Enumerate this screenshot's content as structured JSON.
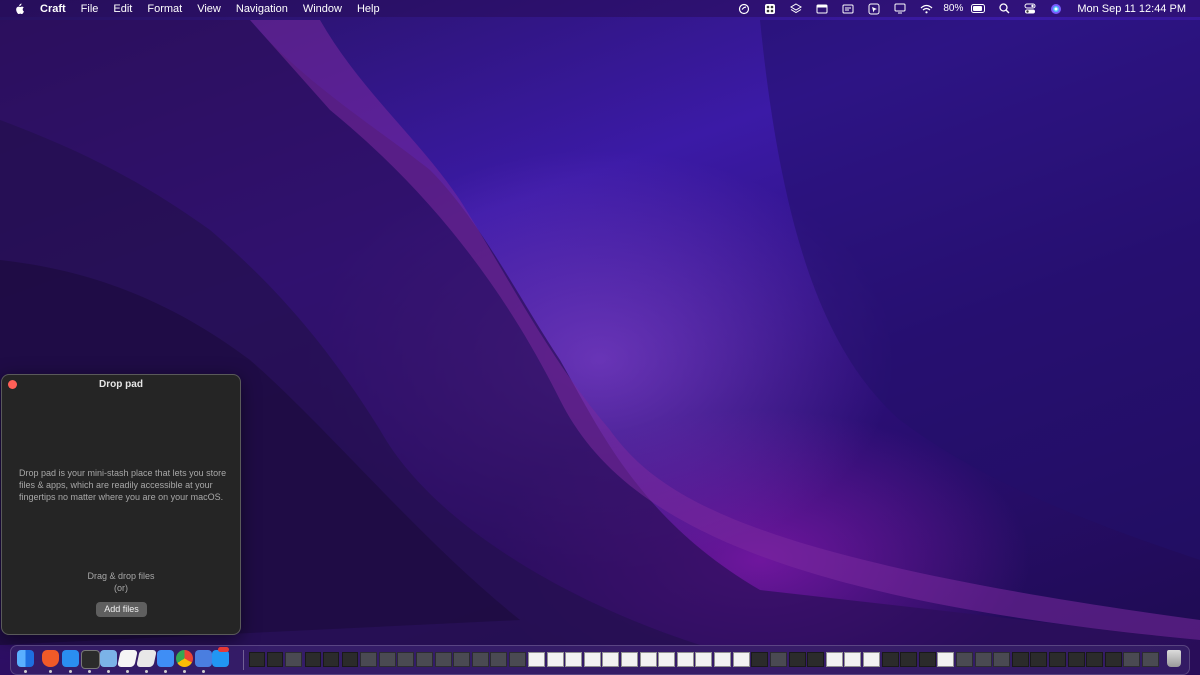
{
  "menubar": {
    "app_name": "Craft",
    "menus": [
      "File",
      "Edit",
      "Format",
      "View",
      "Navigation",
      "Window",
      "Help"
    ],
    "status_icons": [
      "focus-icon",
      "tools-icon",
      "layers-icon",
      "window-icon",
      "display-icon",
      "cursor-icon",
      "monitor-icon",
      "wifi-icon"
    ],
    "battery_percent": "80%",
    "clock": "Mon Sep 11  12:44 PM"
  },
  "drop_pad": {
    "title": "Drop pad",
    "description": "Drop pad is your mini-stash place that lets you store files & apps, which are readily accessible at your fingertips no matter where you are on your macOS.",
    "drag_text": "Drag & drop files",
    "or_text": "(or)",
    "add_button_label": "Add files"
  },
  "dock": {
    "apps": [
      {
        "name": "finder-icon",
        "color": "#1e7cf2"
      },
      {
        "name": "brave-icon",
        "color": "#f05a28"
      },
      {
        "name": "vscode-icon",
        "color": "#2a8ef0"
      },
      {
        "name": "terminal-icon",
        "color": "#2b2b2b"
      },
      {
        "name": "preview-icon",
        "color": "#7bb3e8"
      },
      {
        "name": "notes-icon",
        "color": "#f5f5f5"
      },
      {
        "name": "notes2-icon",
        "color": "#e8e8e8"
      },
      {
        "name": "xcode-icon",
        "color": "#3f8ef5"
      },
      {
        "name": "chrome-icon",
        "color": "#34a853"
      },
      {
        "name": "migrate-icon",
        "color": "#4a7ee0"
      },
      {
        "name": "app-store-icon",
        "color": "#2196f3"
      }
    ],
    "trash_icon": "trash-icon"
  },
  "colors": {
    "close_button": "#ff5f57",
    "window_bg": "#252525",
    "add_button_bg": "#5f5f5f"
  }
}
